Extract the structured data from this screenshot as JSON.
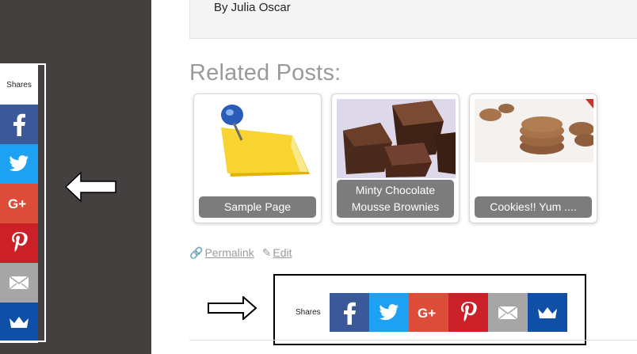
{
  "author": {
    "byline": "By Julia Oscar"
  },
  "related": {
    "title": "Related Posts:",
    "cards": [
      {
        "caption": "Sample Page",
        "image": "sticky-note-pin-image"
      },
      {
        "caption": "Minty Chocolate Mousse Brownies",
        "image": "brownies-image"
      },
      {
        "caption": "Cookies!! Yum ....",
        "image": "cookies-image"
      }
    ]
  },
  "post_links": {
    "permalink": "Permalink",
    "edit": "Edit"
  },
  "share_bar": {
    "label": "Shares",
    "buttons": [
      {
        "name": "facebook",
        "icon": "facebook-icon",
        "color": "#3b5998"
      },
      {
        "name": "twitter",
        "icon": "twitter-icon",
        "color": "#1da1f2"
      },
      {
        "name": "google-plus",
        "icon": "google-plus-icon",
        "color": "#dd4b39"
      },
      {
        "name": "pinterest",
        "icon": "pinterest-icon",
        "color": "#cb2027"
      },
      {
        "name": "email",
        "icon": "email-icon",
        "color": "#a6a6a6"
      },
      {
        "name": "sumo",
        "icon": "crown-icon",
        "color": "#0f4fa8"
      }
    ]
  },
  "sidebar_share": {
    "label": "Shares"
  },
  "annotations": {
    "left_arrow": "arrow-left-outline",
    "right_arrow": "arrow-right-outline"
  }
}
